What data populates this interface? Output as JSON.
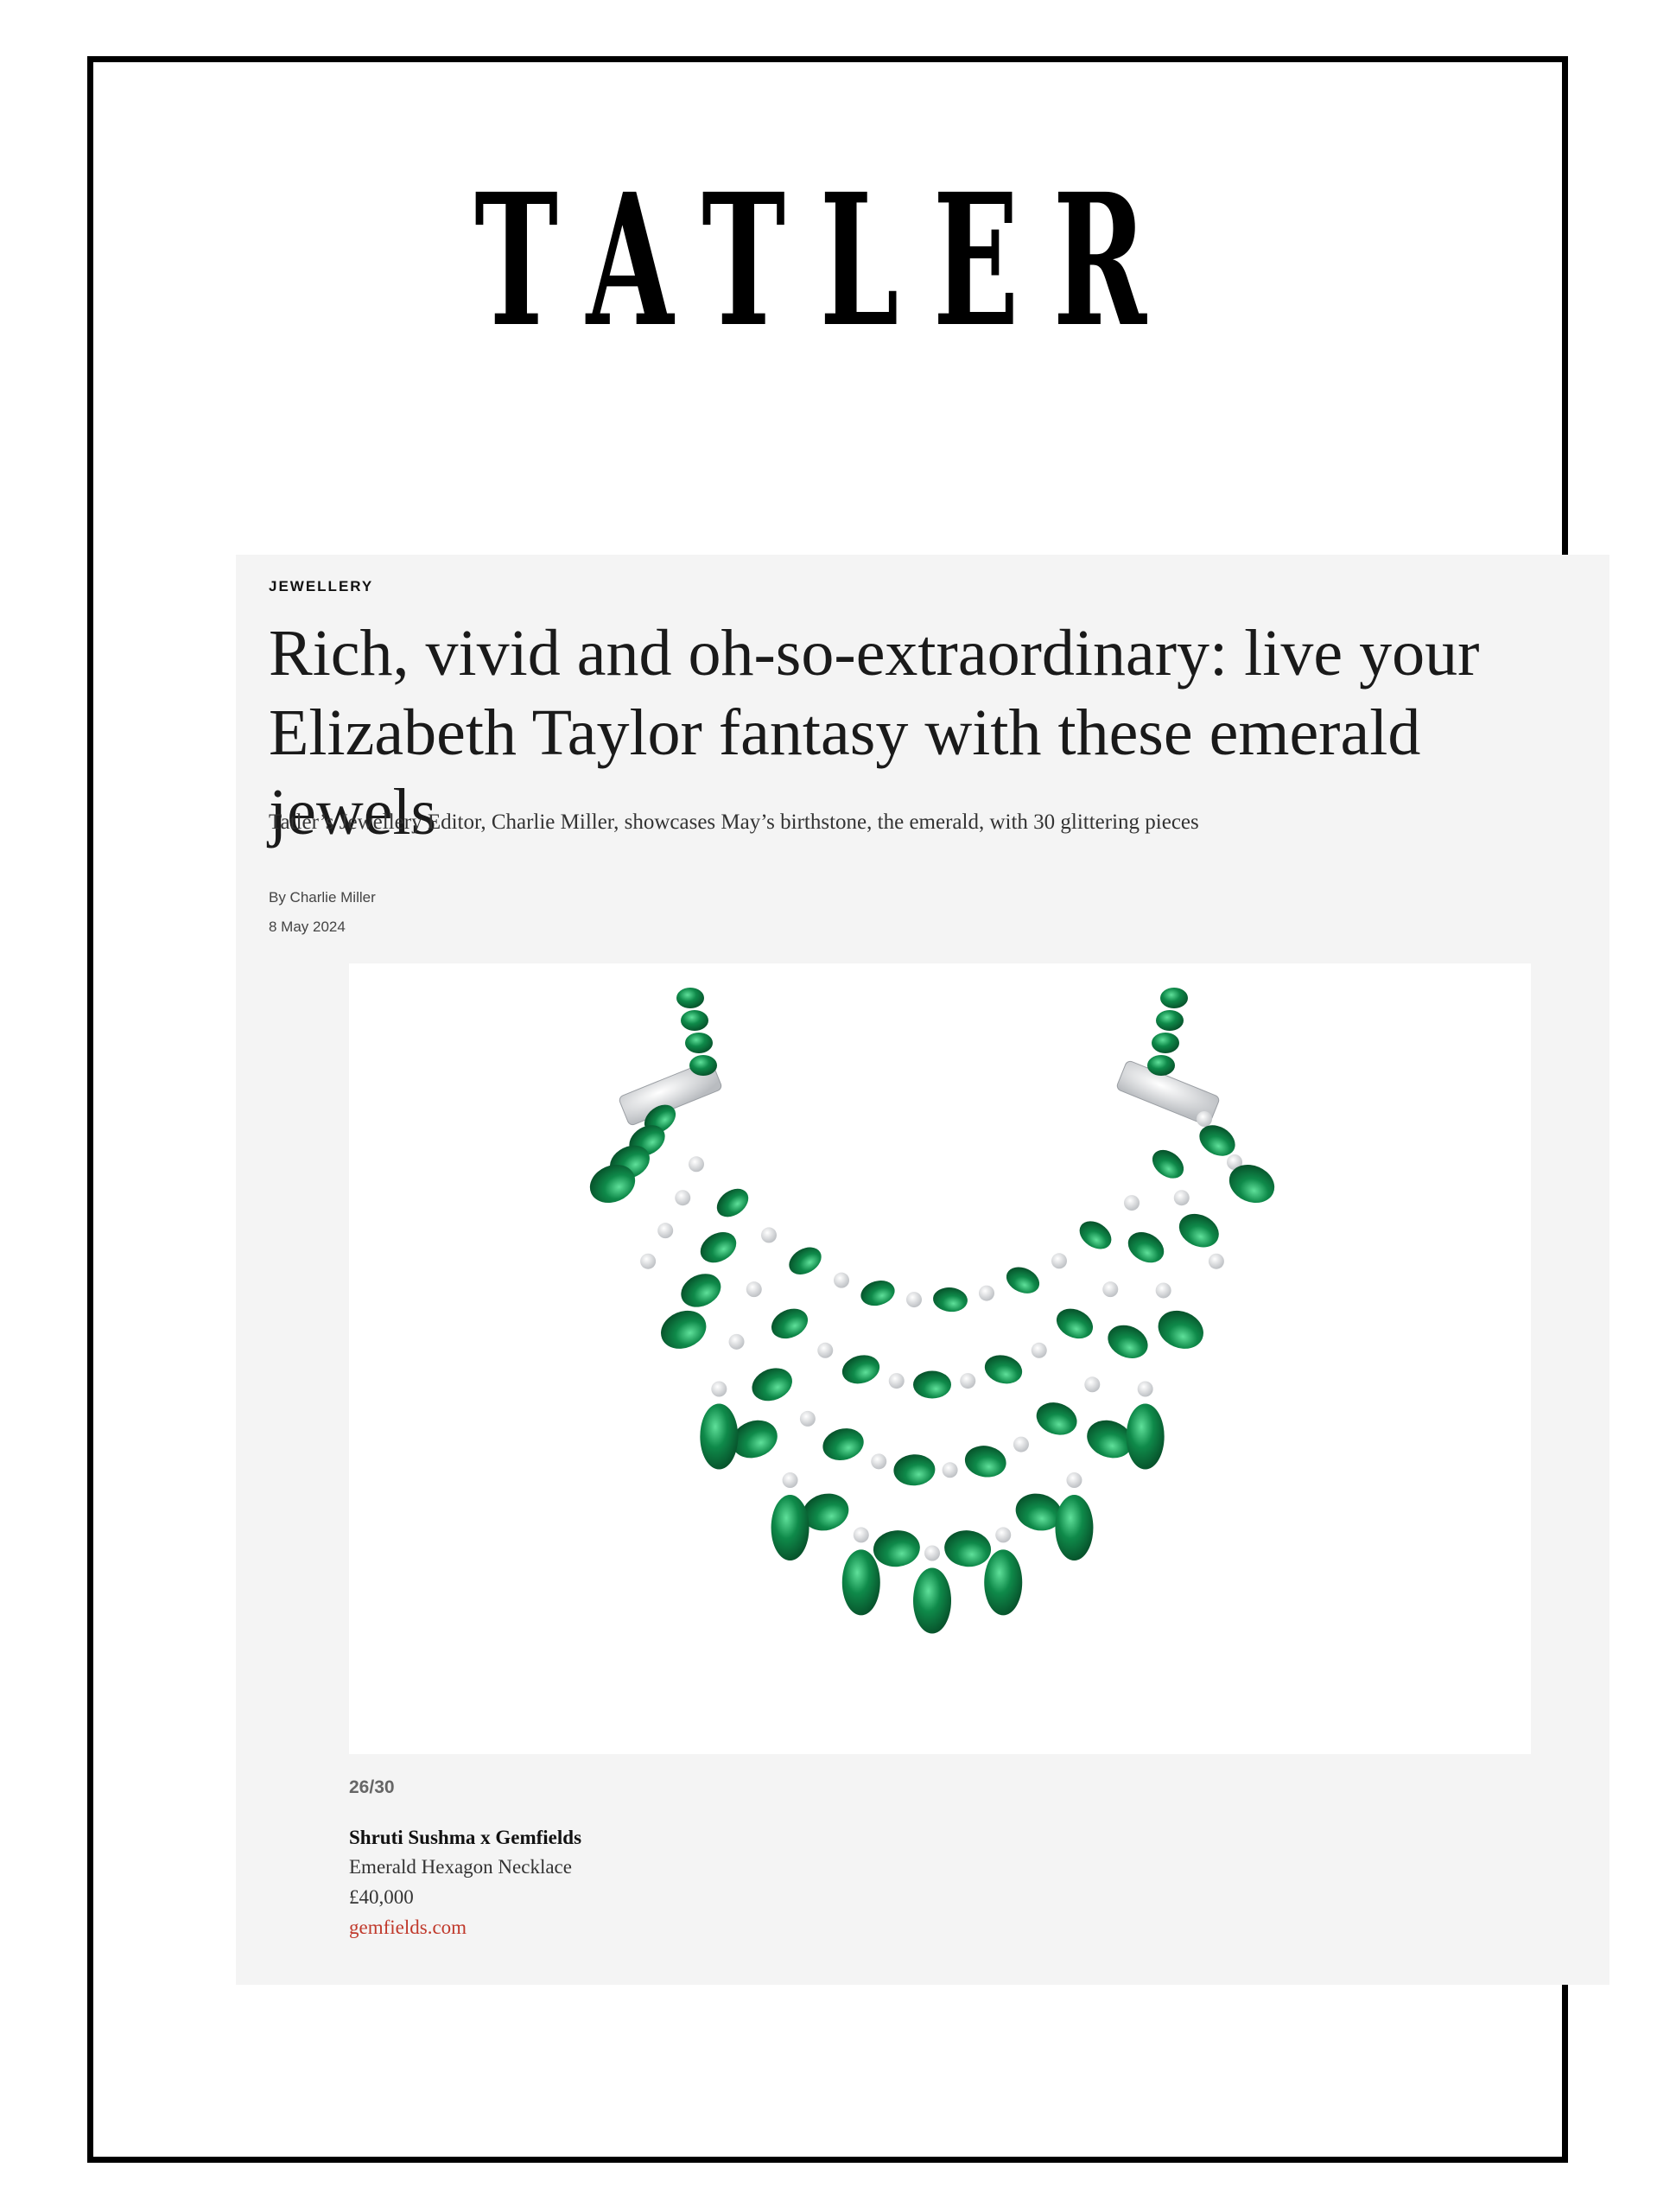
{
  "masthead": {
    "title": "TATLER"
  },
  "article": {
    "rubric": "JEWELLERY",
    "headline_line1": "Rich, vivid and oh-so-extraordinary: live your",
    "headline_line2": "Elizabeth Taylor fantasy with these emerald jewels",
    "dek": "Tatler’s Jewellery Editor, Charlie Miller, showcases May’s birthstone, the emerald, with 30 glittering pieces",
    "byline": "By Charlie Miller",
    "date": "8 May 2024"
  },
  "gallery": {
    "image_subject": "emerald-necklace-illustration",
    "counter": "26/30",
    "brand": "Shruti Sushma x Gemfields",
    "product": "Emerald Hexagon Necklace",
    "price": "£40,000",
    "link": "gemfields.com"
  },
  "colors": {
    "frame": "#000000",
    "card_background": "#f4f4f4",
    "emerald": "#0f8a4a",
    "link": "#c0392b"
  }
}
